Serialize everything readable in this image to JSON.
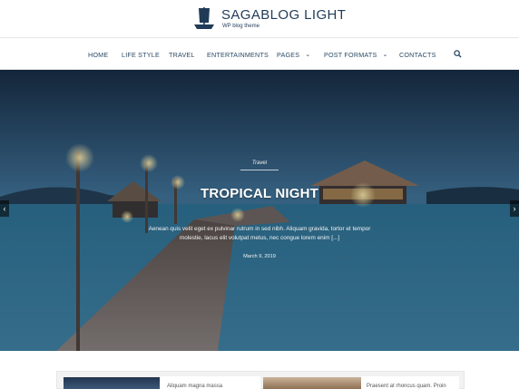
{
  "site": {
    "title": "SAGABLOG LIGHT",
    "tagline": "WP blog theme"
  },
  "nav": {
    "items": [
      {
        "label": "HOME"
      },
      {
        "label": "LIFE STYLE"
      },
      {
        "label": "TRAVEL"
      },
      {
        "label": "ENTERTAINMENTS"
      },
      {
        "label": "PAGES"
      },
      {
        "label": "POST FORMATS"
      },
      {
        "label": "CONTACTS"
      }
    ]
  },
  "slider": {
    "category": "Travel",
    "title": "TROPICAL NIGHT",
    "excerpt": "Aenean quis velit eget ex pulvinar rutrum in sed nibh. Aliquam gravida, tortor et tempor molestie, lacus elit volutpat metus, nec congue lorem enim [...]",
    "date": "March 9, 2019"
  },
  "posts": [
    {
      "title": "Aliquam magna massa"
    },
    {
      "title": "Praesent at rhoncus quam. Proin"
    }
  ],
  "colors": {
    "brand": "#1f3b57",
    "nav_text": "#2a4a66"
  }
}
